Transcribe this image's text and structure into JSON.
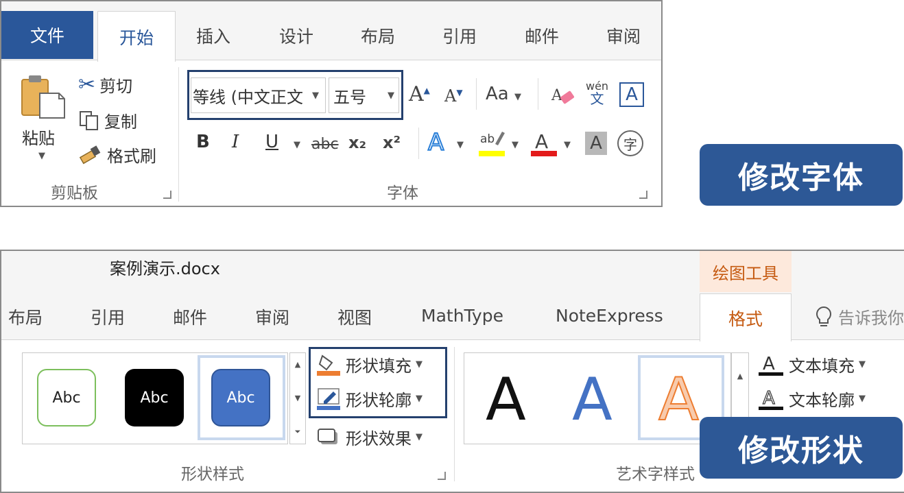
{
  "top": {
    "tabs": {
      "file": "文件",
      "home": "开始",
      "insert": "插入",
      "design": "设计",
      "layout": "布局",
      "references": "引用",
      "mailings": "邮件",
      "review": "审阅"
    },
    "clipboard": {
      "paste": "粘贴",
      "cut": "剪切",
      "copy": "复制",
      "format_painter": "格式刷",
      "group": "剪贴板"
    },
    "font": {
      "font_name": "等线 (中文正文",
      "font_size": "五号",
      "change_case": "Aa",
      "phonetic": "wén",
      "phonetic_char": "文",
      "group": "字体",
      "buttons": {
        "bold": "B",
        "italic": "I",
        "underline": "U",
        "strike": "abc",
        "subscript": "x₂",
        "superscript": "x²"
      }
    }
  },
  "badges": {
    "font": "修改字体",
    "shape": "修改形状"
  },
  "bottom": {
    "doc_title": "案例演示.docx",
    "context_tab": "绘图工具",
    "tabs": {
      "layout": "布局",
      "references": "引用",
      "mailings": "邮件",
      "review": "审阅",
      "view": "视图",
      "mathtype": "MathType",
      "noteexpress": "NoteExpress",
      "format": "格式",
      "tell": "告诉我你"
    },
    "shape_styles": {
      "sample": "Abc",
      "fill": "形状填充",
      "outline": "形状轮廓",
      "effects": "形状效果",
      "group": "形状样式"
    },
    "wordart": {
      "sample": "A",
      "text_fill": "文本填充",
      "text_outline": "文本轮廓",
      "group": "艺术字样式"
    }
  },
  "colors": {
    "accent": "#2a579a",
    "badge": "#2d5896",
    "highlight_box": "#24406e",
    "context_orange": "#c55a11",
    "red": "#e31b1b",
    "yellow": "#ffff00"
  }
}
